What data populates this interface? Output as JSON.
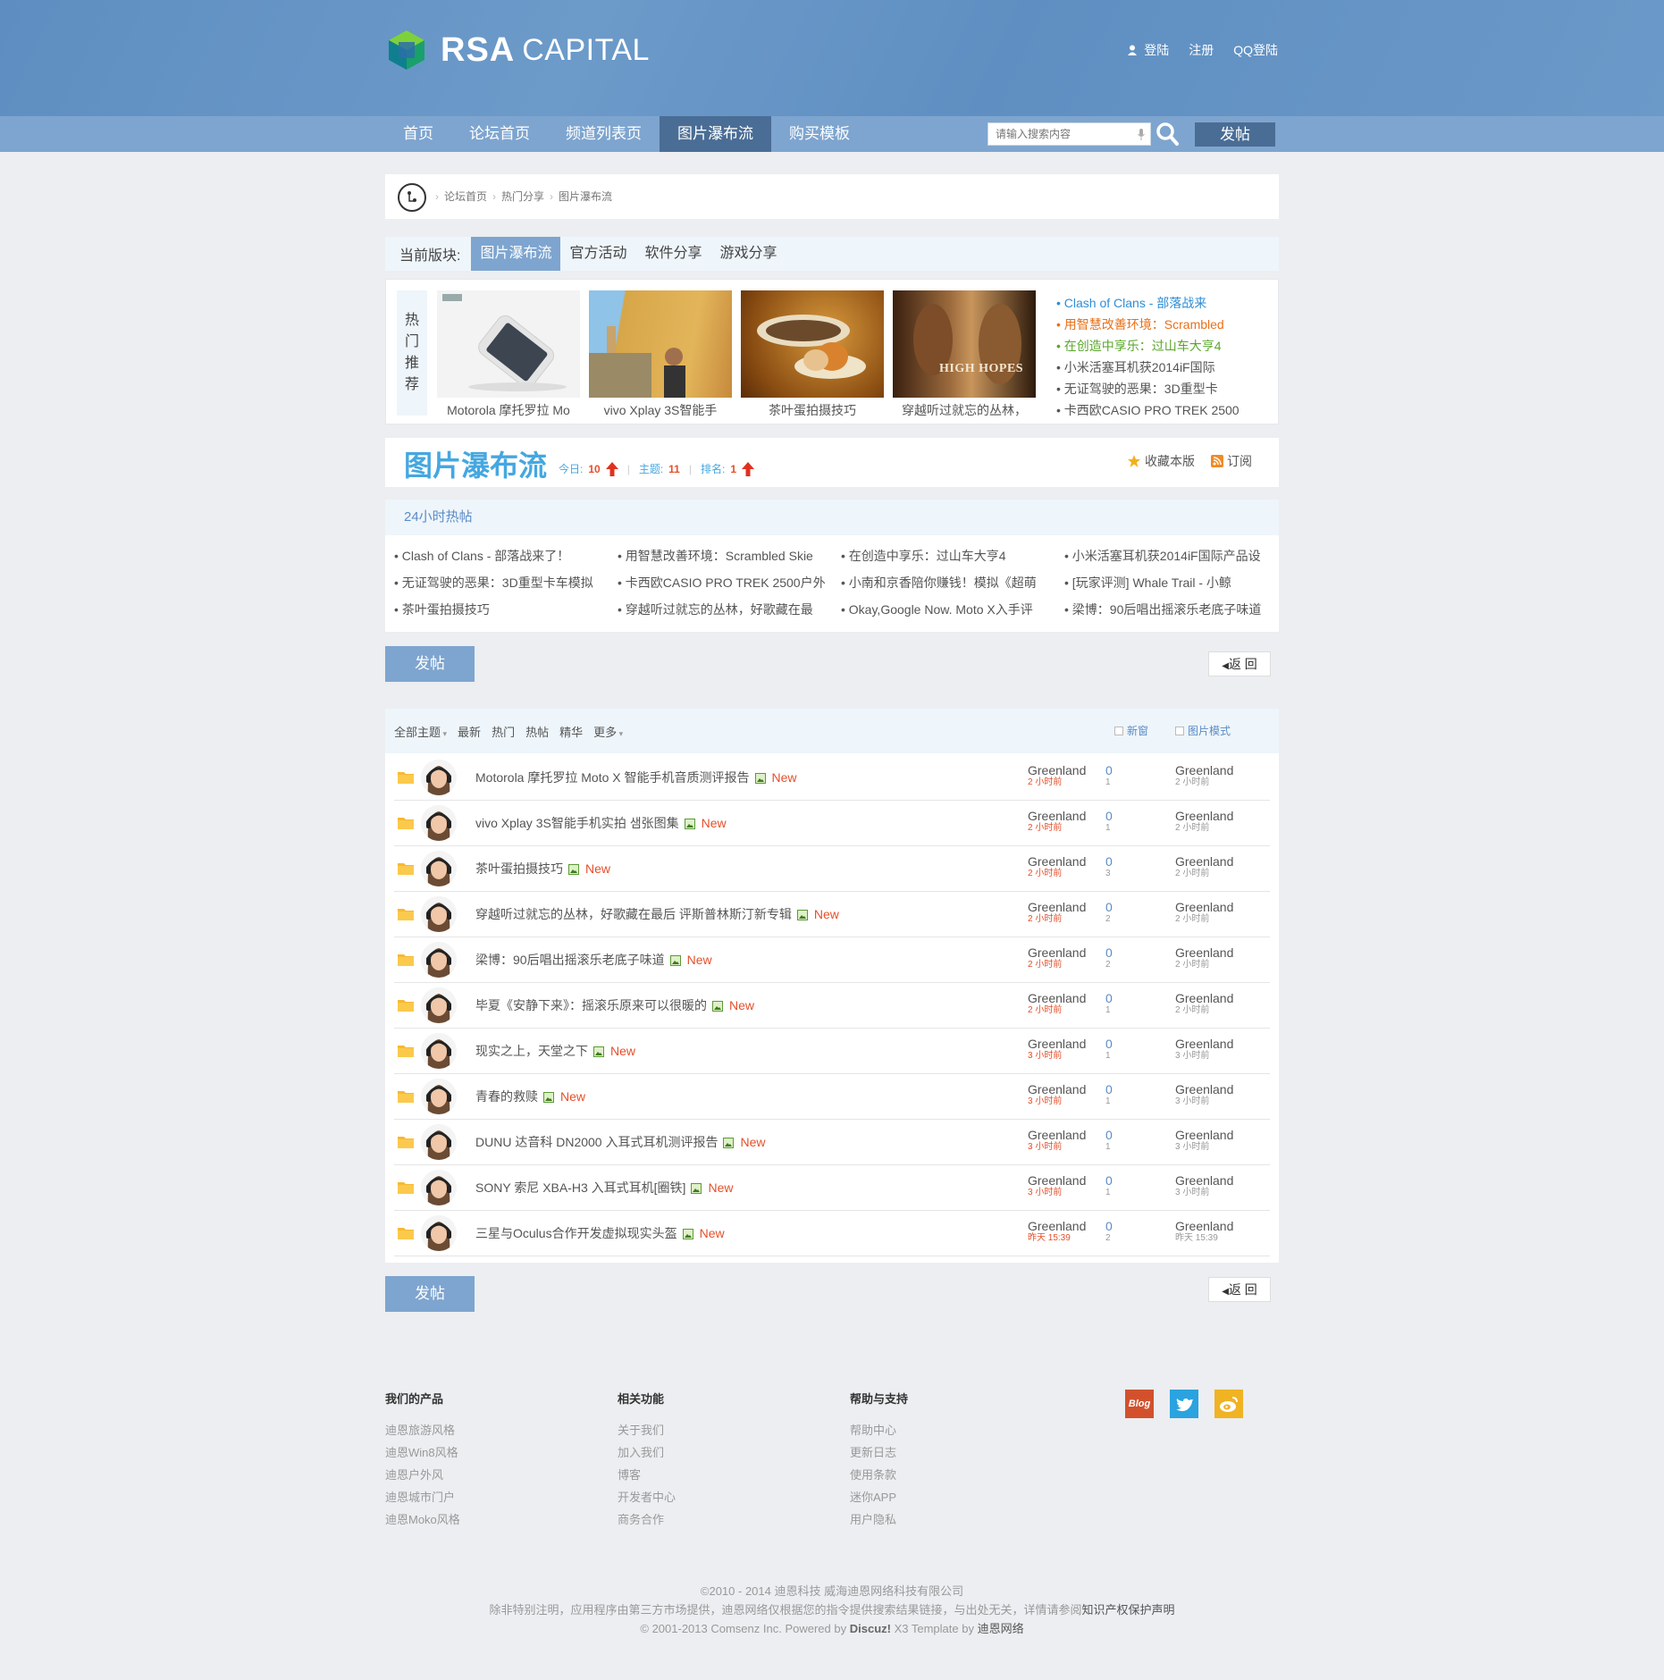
{
  "header": {
    "logo_bold": "RSA",
    "logo_light": "CAPITAL",
    "login": "登陆",
    "register": "注册",
    "qq_login": "QQ登陆"
  },
  "nav": {
    "items": [
      "首页",
      "论坛首页",
      "频道列表页",
      "图片瀑布流",
      "购买模板"
    ],
    "active_index": 3,
    "search_placeholder": "请输入搜索内容",
    "post_label": "发帖"
  },
  "breadcrumb": [
    "论坛首页",
    "热门分享",
    "图片瀑布流"
  ],
  "board": {
    "label": "当前版块:",
    "tabs": [
      "图片瀑布流",
      "官方活动",
      "软件分享",
      "游戏分享"
    ],
    "active_index": 0
  },
  "hot": {
    "vertical_title": [
      "热",
      "门",
      "推",
      "荐"
    ],
    "pics": [
      {
        "caption": "Motorola 摩托罗拉 Mo",
        "overlay": ""
      },
      {
        "caption": "vivo Xplay 3S智能手",
        "overlay": ""
      },
      {
        "caption": "茶叶蛋拍摄技巧",
        "overlay": ""
      },
      {
        "caption": "穿越听过就忘的丛林，",
        "overlay": "HIGH HOPES"
      }
    ],
    "links": [
      {
        "text": "Clash of Clans - 部落战来",
        "color": "#2e8ed6"
      },
      {
        "text": "用智慧改善环境：Scrambled",
        "color": "#e8701a"
      },
      {
        "text": "在创造中享乐：过山车大亨4",
        "color": "#5aa72a"
      },
      {
        "text": "小米活塞耳机获2014iF国际",
        "color": "#555555"
      },
      {
        "text": "无证驾驶的恶果：3D重型卡",
        "color": "#555555"
      },
      {
        "text": "卡西欧CASIO PRO TREK 2500",
        "color": "#555555"
      }
    ]
  },
  "forum": {
    "title": "图片瀑布流",
    "today_label": "今日:",
    "today": "10",
    "topics_label": "主题:",
    "topics": "11",
    "rank_label": "排名:",
    "rank": "1",
    "favorite": "收藏本版",
    "subscribe": "订阅"
  },
  "hot24": {
    "title": "24小时热帖",
    "items": [
      "Clash of Clans - 部落战来了！",
      "用智慧改善环境：Scrambled Skie",
      "在创造中享乐：过山车大亨4",
      "小米活塞耳机获2014iF国际产品设",
      "无证驾驶的恶果：3D重型卡车模拟",
      "卡西欧CASIO PRO TREK 2500户外",
      "小南和京香陪你赚钱！模拟《超萌",
      "[玩家评测] Whale Trail - 小鲸",
      "茶叶蛋拍摄技巧",
      "穿越听过就忘的丛林，好歌藏在最",
      "Okay,Google Now. Moto X入手评",
      "梁博：90后唱出摇滚乐老底子味道"
    ]
  },
  "actions": {
    "post": "发帖",
    "back": "返 回"
  },
  "filter": {
    "all": "全部主题",
    "tabs": [
      "最新",
      "热门",
      "热帖",
      "精华"
    ],
    "more": "更多",
    "new_window": "新窗",
    "pic_mode": "图片模式"
  },
  "threads": [
    {
      "title": "Motorola 摩托罗拉 Moto X 智能手机音质测评报告",
      "author": "Greenland",
      "time": "2 小时前",
      "replies": "0",
      "views": "1",
      "last": "Greenland",
      "last_time": "2 小时前"
    },
    {
      "title": "vivo Xplay 3S智能手机实拍 샘张图集",
      "author": "Greenland",
      "time": "2 小时前",
      "replies": "0",
      "views": "1",
      "last": "Greenland",
      "last_time": "2 小时前"
    },
    {
      "title": "茶叶蛋拍摄技巧",
      "author": "Greenland",
      "time": "2 小时前",
      "replies": "0",
      "views": "3",
      "last": "Greenland",
      "last_time": "2 小时前"
    },
    {
      "title": "穿越听过就忘的丛林，好歌藏在最后 评斯普林斯汀新专辑",
      "author": "Greenland",
      "time": "2 小时前",
      "replies": "0",
      "views": "2",
      "last": "Greenland",
      "last_time": "2 小时前"
    },
    {
      "title": "梁博：90后唱出摇滚乐老底子味道",
      "author": "Greenland",
      "time": "2 小时前",
      "replies": "0",
      "views": "2",
      "last": "Greenland",
      "last_time": "2 小时前"
    },
    {
      "title": "毕夏《安静下来》：摇滚乐原来可以很暖的",
      "author": "Greenland",
      "time": "2 小时前",
      "replies": "0",
      "views": "1",
      "last": "Greenland",
      "last_time": "2 小时前"
    },
    {
      "title": "现实之上，天堂之下",
      "author": "Greenland",
      "time": "3 小时前",
      "replies": "0",
      "views": "1",
      "last": "Greenland",
      "last_time": "3 小时前"
    },
    {
      "title": "青春的救赎",
      "author": "Greenland",
      "time": "3 小时前",
      "replies": "0",
      "views": "1",
      "last": "Greenland",
      "last_time": "3 小时前"
    },
    {
      "title": "DUNU 达音科 DN2000 入耳式耳机测评报告",
      "author": "Greenland",
      "time": "3 小时前",
      "replies": "0",
      "views": "1",
      "last": "Greenland",
      "last_time": "3 小时前"
    },
    {
      "title": "SONY 索尼 XBA-H3 入耳式耳机[圈铁]",
      "author": "Greenland",
      "time": "3 小时前",
      "replies": "0",
      "views": "1",
      "last": "Greenland",
      "last_time": "3 小时前"
    },
    {
      "title": "三星与Oculus合作开发虚拟现实头盔",
      "author": "Greenland",
      "time": "昨天 15:39",
      "replies": "0",
      "views": "2",
      "last": "Greenland",
      "last_time": "昨天 15:39"
    }
  ],
  "new_label": "New",
  "footer": {
    "cols": [
      {
        "title": "我们的产品",
        "links": [
          "迪恩旅游风格",
          "迪恩Win8风格",
          "迪恩户外风",
          "迪恩城市门户",
          "迪恩Moko风格"
        ]
      },
      {
        "title": "相关功能",
        "links": [
          "关于我们",
          "加入我们",
          "博客",
          "开发者中心",
          "商务合作"
        ]
      },
      {
        "title": "帮助与支持",
        "links": [
          "帮助中心",
          "更新日志",
          "使用条款",
          "迷你APP",
          "用户隐私"
        ]
      }
    ],
    "social": [
      {
        "name": "blog",
        "label": "Blog",
        "color": "#d2512c"
      },
      {
        "name": "twitter",
        "label": "",
        "color": "#2aa3e0"
      },
      {
        "name": "weibo",
        "label": "",
        "color": "#f0b323"
      }
    ],
    "copyright": "©2010 - 2014 迪恩科技 威海迪恩网络科技有限公司",
    "disclaimer": "除非特别注明，应用程序由第三方市场提供，迪恩网络仅根据您的指令提供搜索结果链接，与出处无关，详情请参阅",
    "disclaimer_link": "知识产权保护声明",
    "powered_prefix": "© 2001-2013 Comsenz Inc.    Powered by",
    "powered_brand": "Discuz!",
    "powered_version": "X3    Template by",
    "template_by": "迪恩网络"
  }
}
